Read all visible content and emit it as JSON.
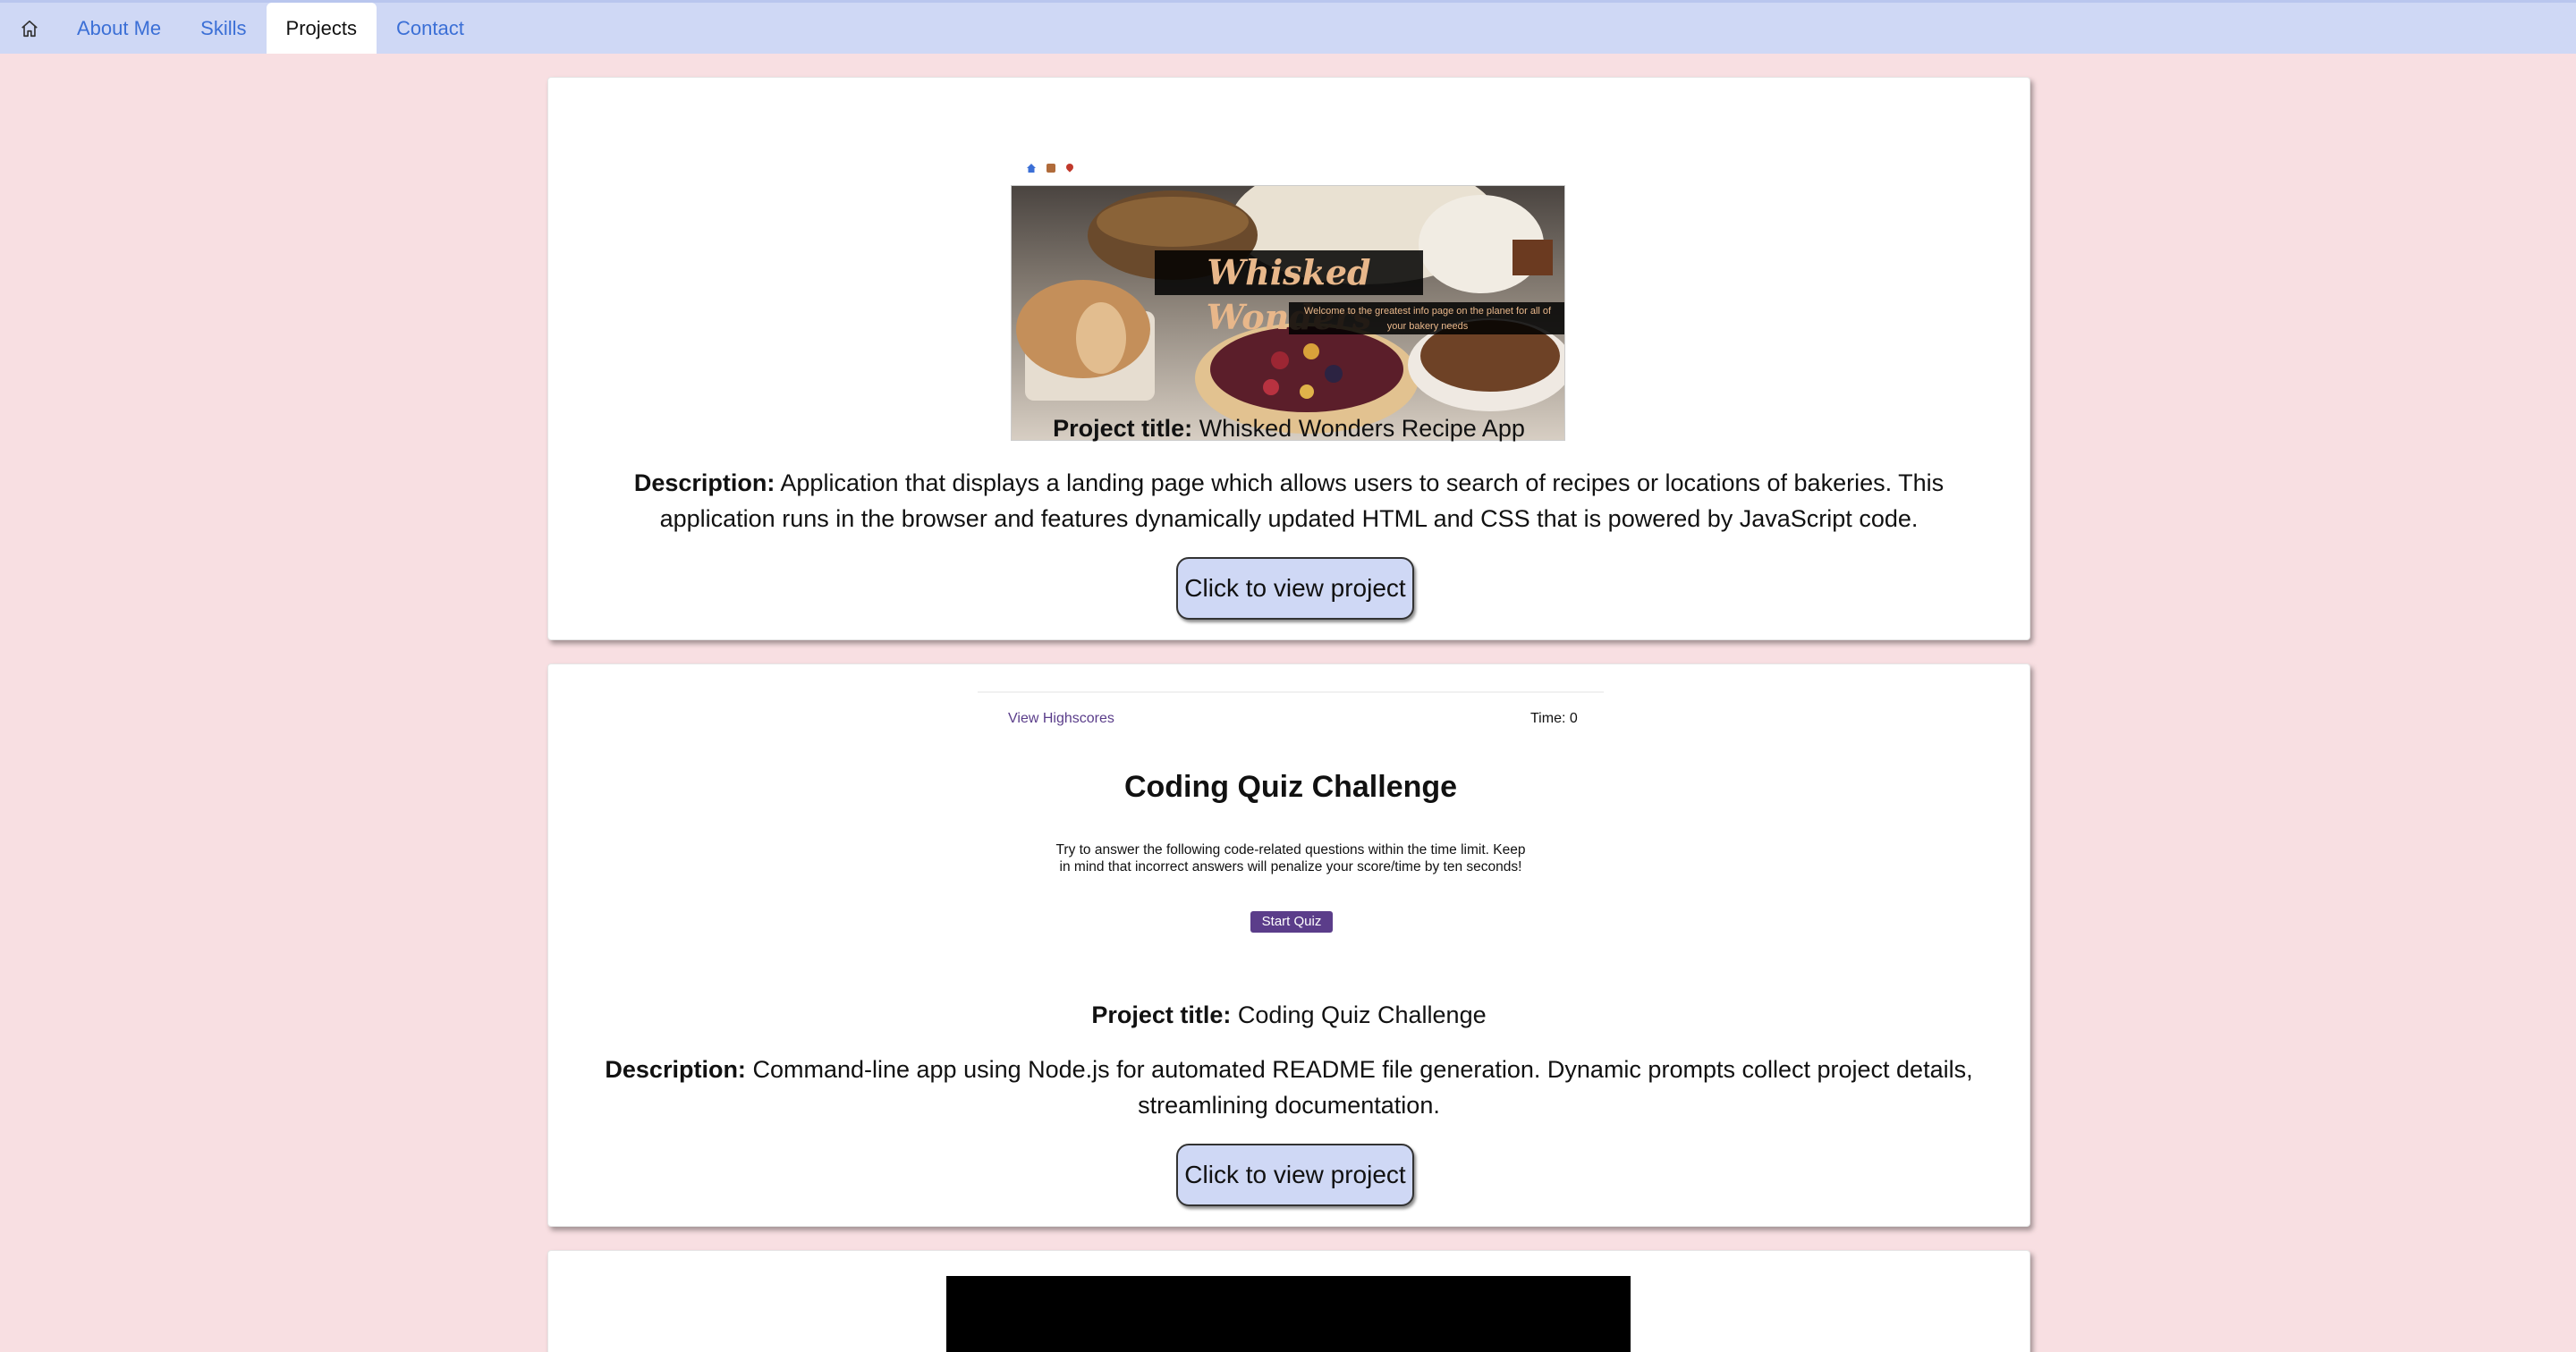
{
  "nav": {
    "home_icon": "home-icon",
    "items": [
      {
        "label": "About Me",
        "active": false
      },
      {
        "label": "Skills",
        "active": false
      },
      {
        "label": "Projects",
        "active": true
      },
      {
        "label": "Contact",
        "active": false
      }
    ]
  },
  "projects": [
    {
      "title_label": "Project title:",
      "title": "Whisked Wonders Recipe App",
      "desc_label": "Description:",
      "description": "Application that displays a landing page which allows users to search of recipes or locations of bakeries. This application runs in the browser and features dynamically updated HTML and CSS that is powered by JavaScript code.",
      "button": "Click to view project",
      "screenshot": {
        "banner_title": "Whisked Wonders",
        "banner_subtitle": "Welcome to the greatest info page on the planet for all of your bakery needs"
      }
    },
    {
      "title_label": "Project title:",
      "title": "Coding Quiz Challenge",
      "desc_label": "Description:",
      "description": "Command-line app using Node.js for automated README file generation. Dynamic prompts collect project details, streamlining documentation.",
      "button": "Click to view project",
      "screenshot": {
        "highscores": "View Highscores",
        "time": "Time: 0",
        "title": "Coding Quiz Challenge",
        "text": "Try to answer the following code-related questions within the time limit. Keep in mind that incorrect answers will penalize your score/time by ten seconds!",
        "start": "Start Quiz"
      }
    }
  ],
  "colors": {
    "background": "#f8dfe2",
    "nav": "#cfd8f5",
    "link": "#3b6fd6",
    "button": "#cfd8f5"
  }
}
